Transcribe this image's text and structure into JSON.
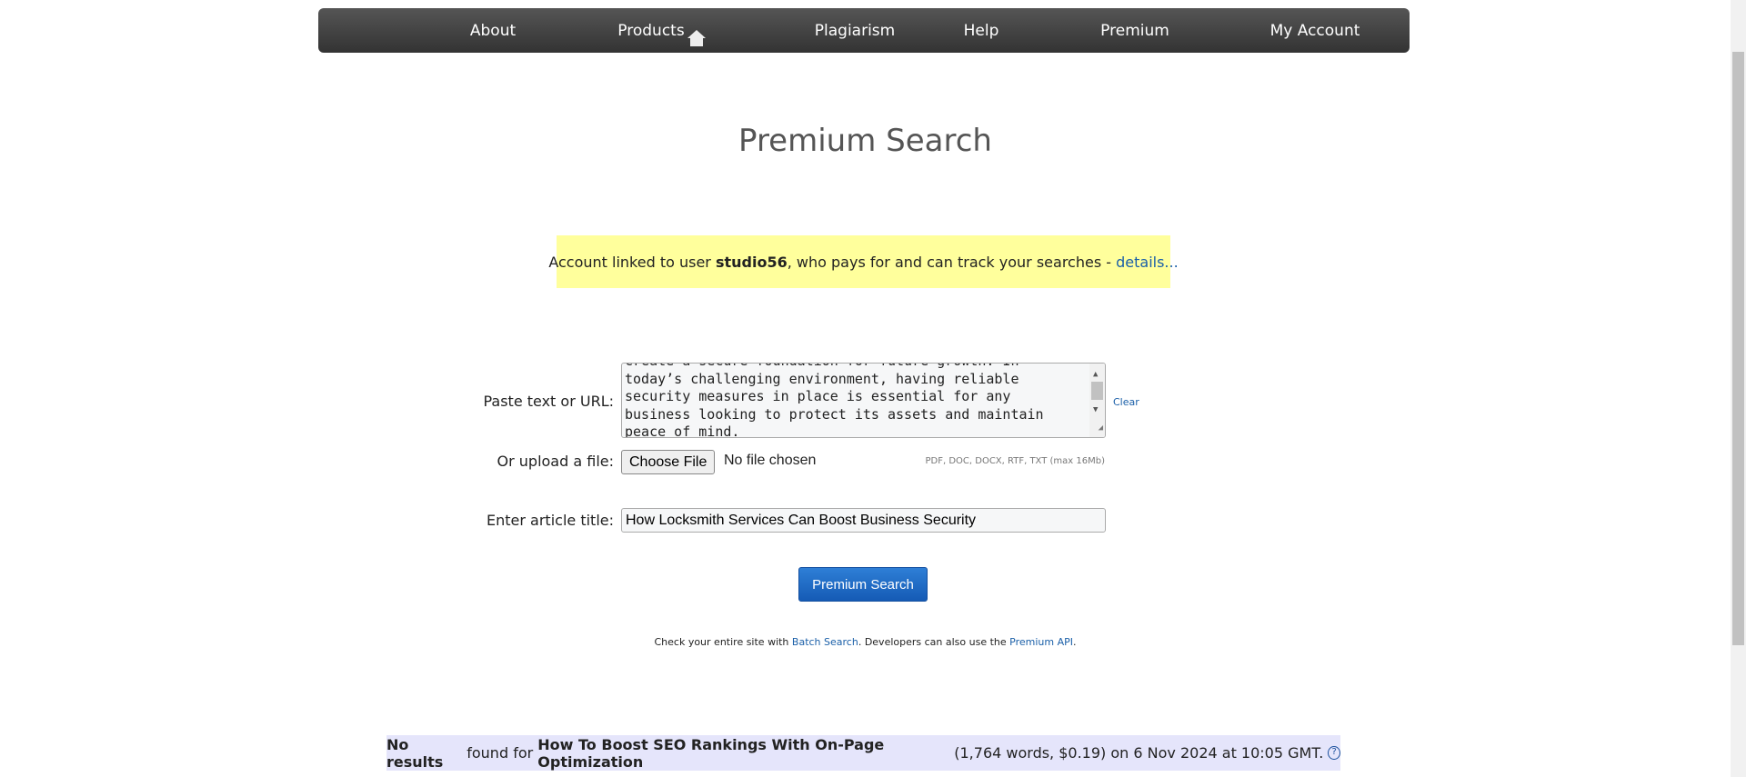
{
  "nav": {
    "home_icon": "house-icon",
    "items": [
      "About",
      "Products",
      "Plagiarism",
      "Help",
      "Premium",
      "My Account"
    ]
  },
  "title": "Premium Search",
  "notice": {
    "prefix": "Account linked to user ",
    "user": "studio56",
    "suffix": ", who pays for and can track your searches - ",
    "link": "details..."
  },
  "form": {
    "paste_label": "Paste text or URL:",
    "paste_value": "create a secure foundation for future growth. In today’s challenging environment, having reliable security measures in place is essential for any business looking to protect its assets and maintain peace of mind.",
    "clear": "Clear",
    "upload_label": "Or upload a file:",
    "choose_file": "Choose File",
    "no_file": "No file chosen",
    "formats": "PDF, DOC, DOCX, RTF, TXT (max 16Mb)",
    "title_label": "Enter article title:",
    "title_value": "How Locksmith Services Can Boost Business Security",
    "submit": "Premium Search"
  },
  "check": {
    "t1": "Check your entire site with ",
    "l1": "Batch Search",
    "t2": ". Developers can also use the ",
    "l2": "Premium API",
    "t3": "."
  },
  "result": {
    "bold1": "No results",
    "t1": " found for ",
    "bold2": "How To Boost SEO Rankings With On-Page Optimization",
    "t2": " (1,764 words, $0.19) on 6 Nov 2024 at 10:05 GMT.",
    "help_icon": "question-circle-icon"
  }
}
